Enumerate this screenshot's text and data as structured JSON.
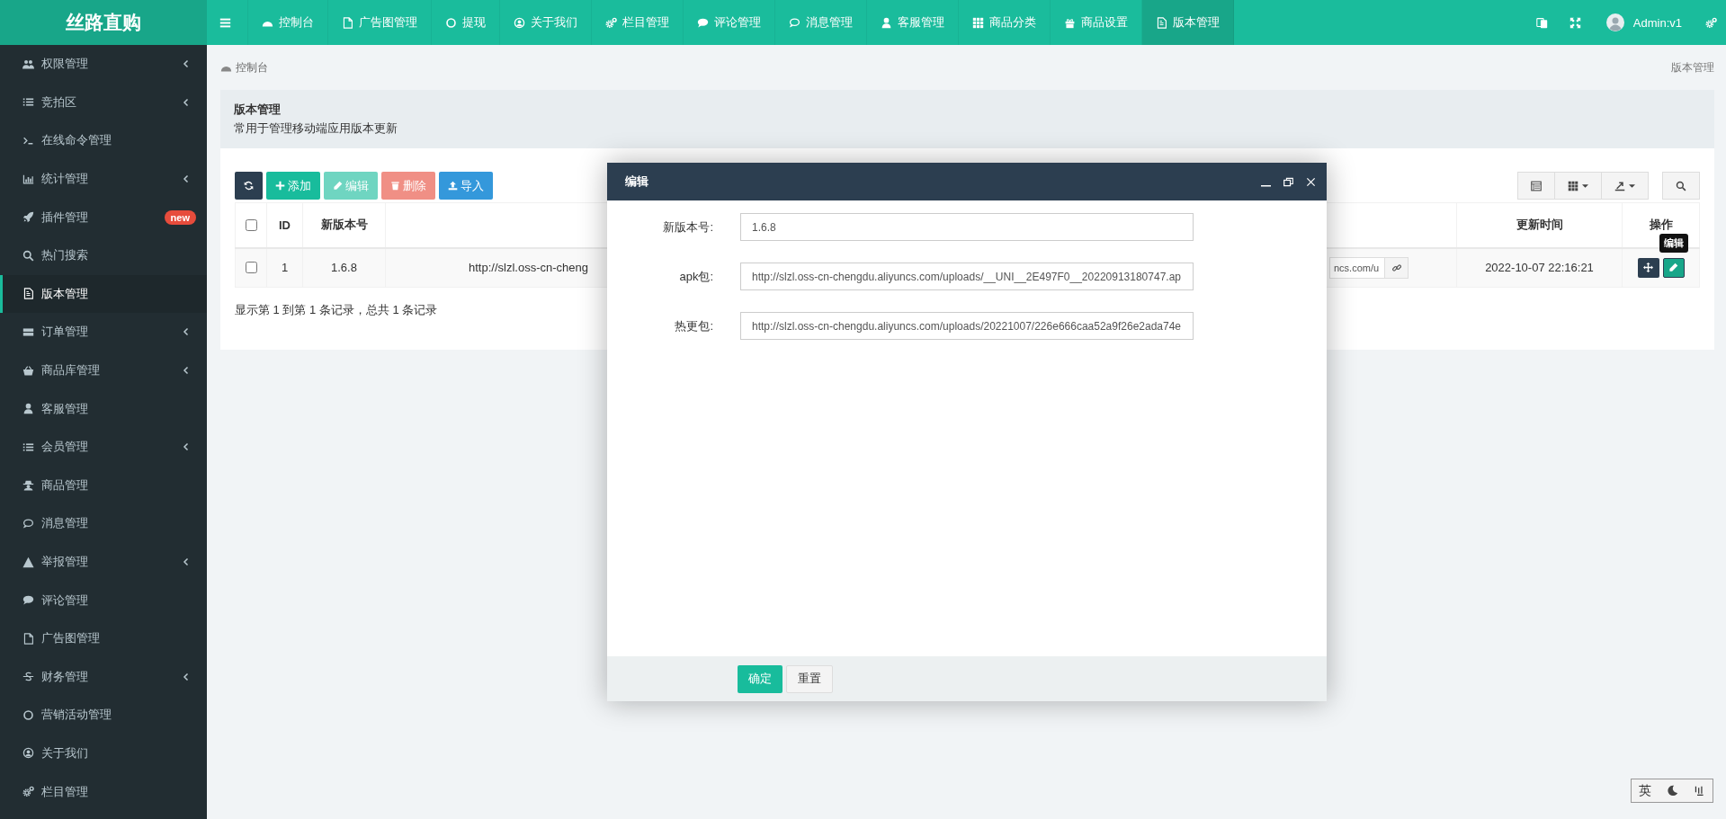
{
  "header": {
    "logo": "丝路直购",
    "nav": [
      {
        "label": "控制台",
        "selected": false
      },
      {
        "label": "广告图管理",
        "selected": false
      },
      {
        "label": "提现",
        "selected": false
      },
      {
        "label": "关于我们",
        "selected": false
      },
      {
        "label": "栏目管理",
        "selected": false
      },
      {
        "label": "评论管理",
        "selected": false
      },
      {
        "label": "消息管理",
        "selected": false
      },
      {
        "label": "客服管理",
        "selected": false
      },
      {
        "label": "商品分类",
        "selected": false
      },
      {
        "label": "商品设置",
        "selected": false
      },
      {
        "label": "版本管理",
        "selected": true
      }
    ],
    "user": "Admin:v1"
  },
  "sidebar": {
    "items": [
      {
        "label": "权限管理",
        "has_submenu": true,
        "selected": false
      },
      {
        "label": "竞拍区",
        "has_submenu": true,
        "selected": false
      },
      {
        "label": "在线命令管理",
        "has_submenu": false,
        "selected": false
      },
      {
        "label": "统计管理",
        "has_submenu": true,
        "selected": false
      },
      {
        "label": "插件管理",
        "has_submenu": false,
        "badge": "new",
        "selected": false
      },
      {
        "label": "热门搜索",
        "has_submenu": false,
        "selected": false
      },
      {
        "label": "版本管理",
        "has_submenu": false,
        "selected": true
      },
      {
        "label": "订单管理",
        "has_submenu": true,
        "selected": false
      },
      {
        "label": "商品库管理",
        "has_submenu": true,
        "selected": false
      },
      {
        "label": "客服管理",
        "has_submenu": false,
        "selected": false
      },
      {
        "label": "会员管理",
        "has_submenu": true,
        "selected": false
      },
      {
        "label": "商品管理",
        "has_submenu": false,
        "selected": false
      },
      {
        "label": "消息管理",
        "has_submenu": false,
        "selected": false
      },
      {
        "label": "举报管理",
        "has_submenu": true,
        "selected": false
      },
      {
        "label": "评论管理",
        "has_submenu": false,
        "selected": false
      },
      {
        "label": "广告图管理",
        "has_submenu": false,
        "selected": false
      },
      {
        "label": "财务管理",
        "has_submenu": true,
        "selected": false
      },
      {
        "label": "营销活动管理",
        "has_submenu": false,
        "selected": false
      },
      {
        "label": "关于我们",
        "has_submenu": false,
        "selected": false
      },
      {
        "label": "栏目管理",
        "has_submenu": false,
        "selected": false
      }
    ]
  },
  "breadcrumb": {
    "current": "控制台",
    "page": "版本管理"
  },
  "panel": {
    "title": "版本管理",
    "description": "常用于管理移动端应用版本更新"
  },
  "toolbar": {
    "buttons": [
      {
        "kind": "refresh",
        "disabled": false
      },
      {
        "kind": "add",
        "label": "添加",
        "disabled": false
      },
      {
        "kind": "edit",
        "label": "编辑",
        "disabled": true
      },
      {
        "kind": "delete",
        "label": "删除",
        "disabled": true
      },
      {
        "kind": "import",
        "label": "导入",
        "disabled": false
      }
    ]
  },
  "table": {
    "columns": [
      {
        "kind": "checkbox",
        "checked": false
      },
      {
        "kind": "text",
        "label": "ID"
      },
      {
        "kind": "text",
        "label": "新版本号"
      },
      {
        "kind": "blank"
      },
      {
        "kind": "blank"
      },
      {
        "kind": "text",
        "label": "更新时间"
      },
      {
        "kind": "text",
        "label": "操作"
      }
    ],
    "rows": [
      {
        "checked": false,
        "id": "1",
        "version": "1.6.8",
        "apk": "http://slzl.oss-cn-cheng",
        "hotfix": "ncs.com/u",
        "updated": "2022-10-07 22:16:21"
      }
    ],
    "tooltip": "编辑"
  },
  "pagination": "显示第 1 到第 1 条记录，总共 1 条记录",
  "modal": {
    "title": "编辑",
    "fields": [
      {
        "label": "新版本号:",
        "value": "1.6.8"
      },
      {
        "label": "apk包:",
        "value": "http://slzl.oss-cn-chengdu.aliyuncs.com/uploads/__UNI__2E497F0__20220913180747.ap"
      },
      {
        "label": "热更包:",
        "value": "http://slzl.oss-cn-chengdu.aliyuncs.com/uploads/20221007/226e666caa52a9f26e2ada74e"
      }
    ],
    "buttons": [
      {
        "kind": "primary",
        "label": "确定"
      },
      {
        "kind": "default",
        "label": "重置"
      }
    ]
  },
  "ime": {
    "language": "英"
  }
}
